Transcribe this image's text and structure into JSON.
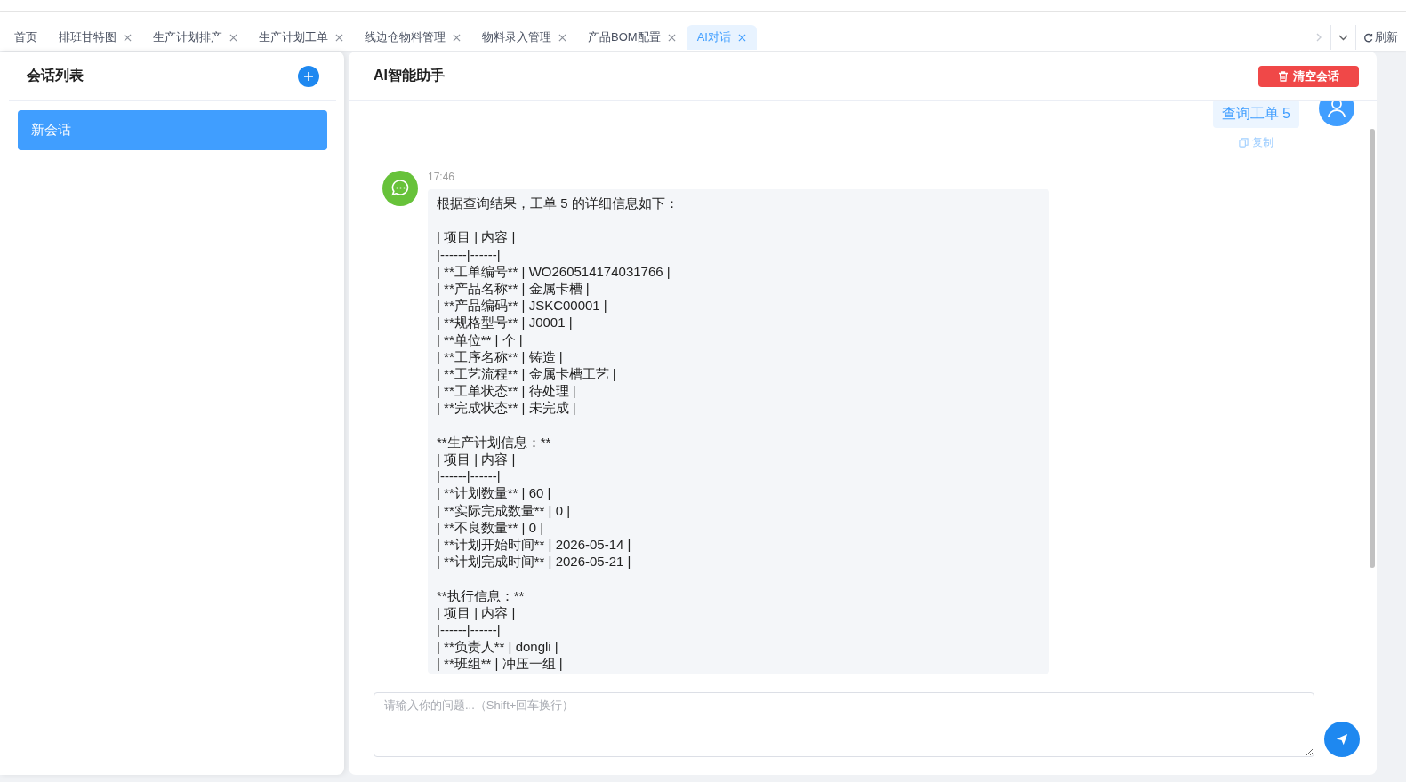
{
  "tabs": [
    {
      "label": "首页",
      "closable": false,
      "selected": false
    },
    {
      "label": "排班甘特图",
      "closable": true,
      "selected": false
    },
    {
      "label": "生产计划排产",
      "closable": true,
      "selected": false
    },
    {
      "label": "生产计划工单",
      "closable": true,
      "selected": false
    },
    {
      "label": "线边仓物料管理",
      "closable": true,
      "selected": false
    },
    {
      "label": "物料录入管理",
      "closable": true,
      "selected": false
    },
    {
      "label": "产品BOM配置",
      "closable": true,
      "selected": false
    },
    {
      "label": "AI对话",
      "closable": true,
      "selected": true
    }
  ],
  "tab_scroll": {
    "disabled": true
  },
  "refresh": {
    "label": "刷新"
  },
  "sidebar": {
    "title": "会话列表",
    "sessions": [
      {
        "title": "新会话",
        "selected": true
      }
    ]
  },
  "chat": {
    "title": "AI智能助手",
    "clear_button": "清空会话",
    "messages": [
      {
        "kind": "user",
        "text": "查询工单 5",
        "action": "复制"
      },
      {
        "kind": "assistant",
        "time": "17:46",
        "blocks": [
          [
            "根据查询结果，工单 5 的详细信息如下："
          ],
          [
            "| 项目 | 内容 |",
            "|------|------|",
            "| **工单编号** | WO260514174031766 |",
            "| **产品名称** | 金属卡槽 |",
            "| **产品编码** | JSKC00001 |",
            "| **规格型号** | J0001 |",
            "| **单位** | 个 |",
            "| **工序名称** | 铸造 |",
            "| **工艺流程** | 金属卡槽工艺 |",
            "| **工单状态** | 待处理 |",
            "| **完成状态** | 未完成 |"
          ],
          [
            "**生产计划信息：**",
            "| 项目 | 内容 |",
            "|------|------|",
            "| **计划数量** | 60 |",
            "| **实际完成数量** | 0 |",
            "| **不良数量** | 0 |",
            "| **计划开始时间** | 2026-05-14 |",
            "| **计划完成时间** | 2026-05-21 |"
          ],
          [
            "**执行信息：**",
            "| 项目 | 内容 |",
            "|------|------|",
            "| **负责人** | dongli |",
            "| **班组** | 冲压一组 |"
          ]
        ]
      }
    ]
  },
  "input": {
    "placeholder": "请输入你的问题...（Shift+回车换行）"
  }
}
